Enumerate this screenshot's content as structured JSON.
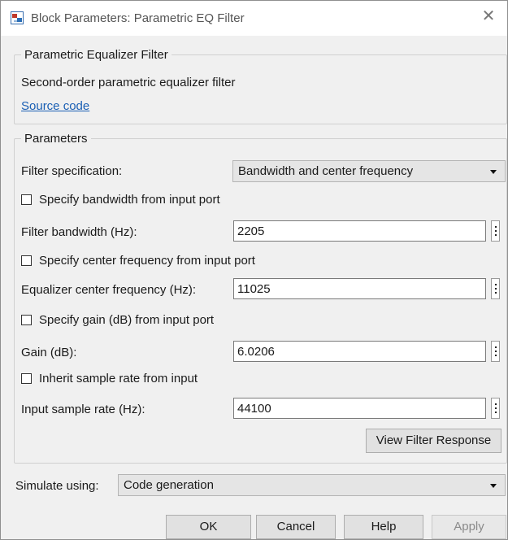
{
  "window": {
    "title": "Block Parameters: Parametric EQ Filter"
  },
  "description_group": {
    "legend": "Parametric Equalizer Filter",
    "description": "Second-order parametric equalizer filter",
    "source_link": "Source code"
  },
  "parameters": {
    "legend": "Parameters",
    "filter_spec": {
      "label": "Filter specification:",
      "value": "Bandwidth and center frequency"
    },
    "cb_bandwidth": {
      "label": "Specify bandwidth from input port",
      "checked": false
    },
    "bandwidth": {
      "label": "Filter bandwidth (Hz):",
      "value": "2205"
    },
    "cb_center": {
      "label": "Specify center frequency from input port",
      "checked": false
    },
    "center": {
      "label": "Equalizer center frequency (Hz):",
      "value": "11025"
    },
    "cb_gain": {
      "label": "Specify gain (dB) from input port",
      "checked": false
    },
    "gain": {
      "label": "Gain (dB):",
      "value": "6.0206"
    },
    "cb_inherit": {
      "label": "Inherit sample rate from input",
      "checked": false
    },
    "sample_rate": {
      "label": "Input sample rate (Hz):",
      "value": "44100"
    },
    "view_response": "View Filter Response"
  },
  "simulate": {
    "label": "Simulate using:",
    "value": "Code generation"
  },
  "buttons": {
    "ok": "OK",
    "cancel": "Cancel",
    "help": "Help",
    "apply": "Apply"
  },
  "icons": {
    "app": "simulink-block-icon",
    "close": "close-icon"
  }
}
